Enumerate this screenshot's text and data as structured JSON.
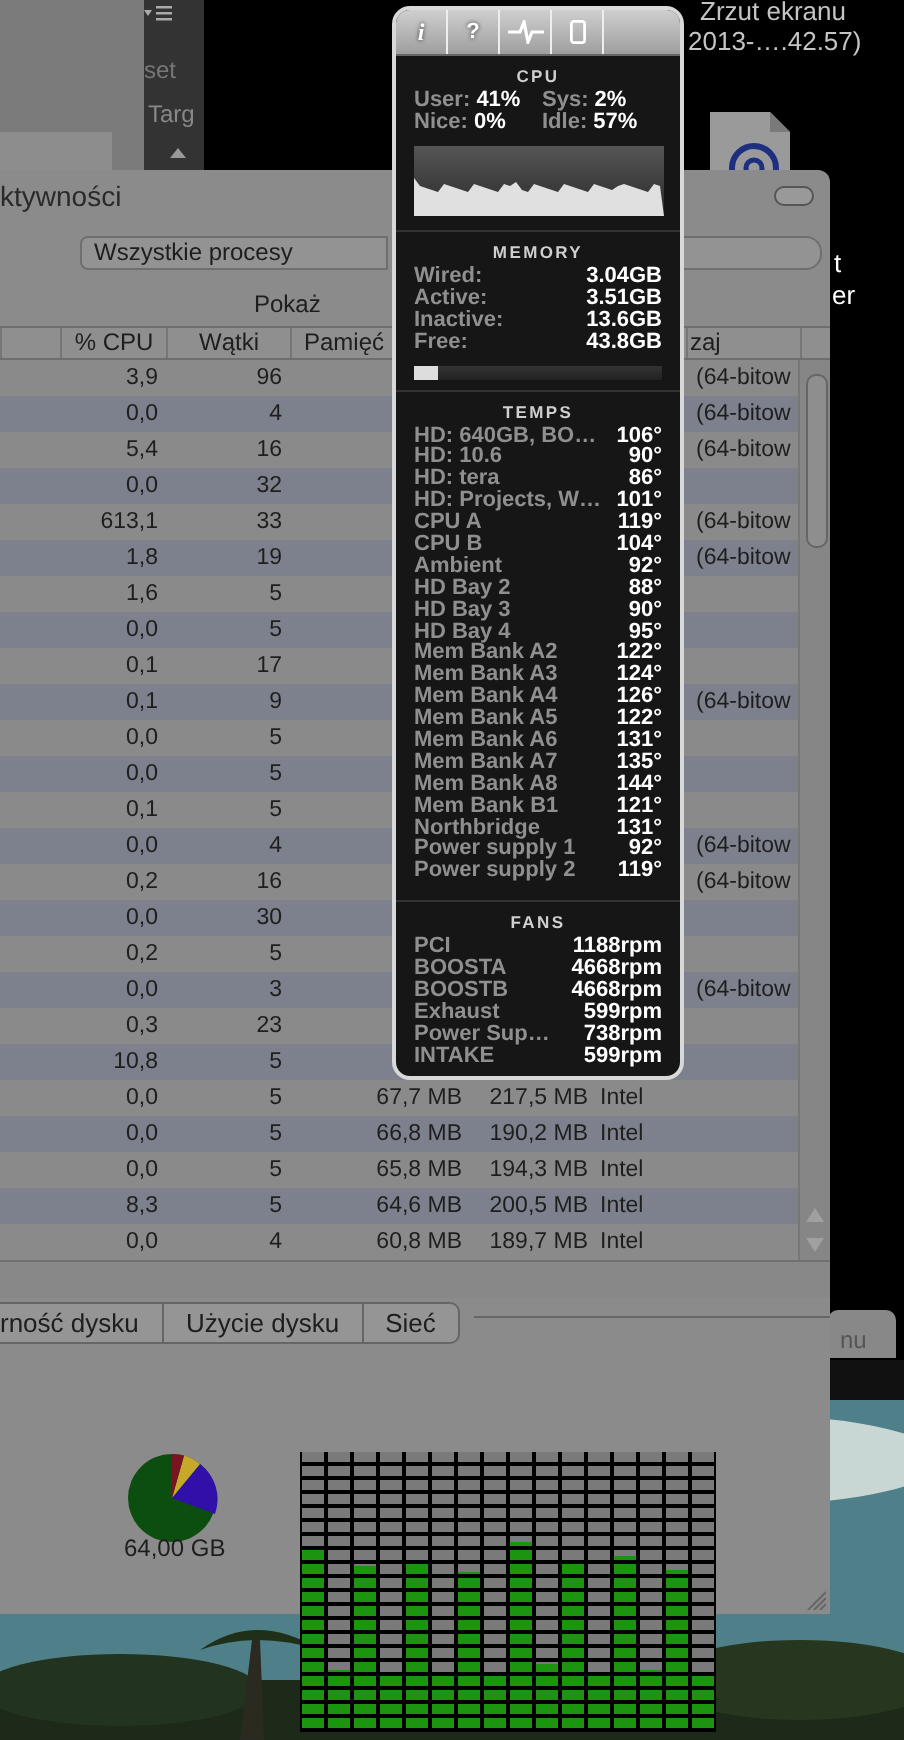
{
  "desktop": {
    "icon_label": "Zrzut ekranu",
    "icon_sublabel": "2013-….42.57)",
    "fragments": [
      {
        "kind": "field",
        "text": "set"
      },
      {
        "kind": "tab",
        "text": "Targ"
      },
      {
        "kind": "label1",
        "text": "t"
      },
      {
        "kind": "label2",
        "text": "er"
      },
      {
        "kind": "label3",
        "text": "nu"
      }
    ]
  },
  "activity_window": {
    "title": "ktywności",
    "filter": "Wszystkie procesy",
    "show_label": "Pokaż",
    "columns": [
      {
        "label": "% CPU"
      },
      {
        "label": "Wątki"
      },
      {
        "label": "Pamięć"
      },
      {
        "label": "zaj"
      }
    ],
    "rows": [
      {
        "cpu": "3,9",
        "threads": "96",
        "arch": "(64-bitow"
      },
      {
        "cpu": "0,0",
        "threads": "4",
        "arch": "(64-bitow"
      },
      {
        "cpu": "5,4",
        "threads": "16",
        "arch": "(64-bitow"
      },
      {
        "cpu": "0,0",
        "threads": "32"
      },
      {
        "cpu": "613,1",
        "threads": "33",
        "arch": "(64-bitow"
      },
      {
        "cpu": "1,8",
        "threads": "19",
        "arch": "(64-bitow"
      },
      {
        "cpu": "1,6",
        "threads": "5"
      },
      {
        "cpu": "0,0",
        "threads": "5"
      },
      {
        "cpu": "0,1",
        "threads": "17"
      },
      {
        "cpu": "0,1",
        "threads": "9",
        "arch": "(64-bitow"
      },
      {
        "cpu": "0,0",
        "threads": "5"
      },
      {
        "cpu": "0,0",
        "threads": "5"
      },
      {
        "cpu": "0,1",
        "threads": "5"
      },
      {
        "cpu": "0,0",
        "threads": "4",
        "arch": "(64-bitow"
      },
      {
        "cpu": "0,2",
        "threads": "16",
        "arch": "(64-bitow"
      },
      {
        "cpu": "0,0",
        "threads": "30"
      },
      {
        "cpu": "0,2",
        "threads": "5"
      },
      {
        "cpu": "0,0",
        "threads": "3",
        "arch": "(64-bitow"
      },
      {
        "cpu": "0,3",
        "threads": "23"
      },
      {
        "cpu": "10,8",
        "threads": "5"
      },
      {
        "cpu": "0,0",
        "threads": "5",
        "real_memory": "67,7 MB",
        "virtual_memory": "217,5 MB",
        "kind": "Intel"
      },
      {
        "cpu": "0,0",
        "threads": "5",
        "real_memory": "66,8 MB",
        "virtual_memory": "190,2 MB",
        "kind": "Intel"
      },
      {
        "cpu": "0,0",
        "threads": "5",
        "real_memory": "65,8 MB",
        "virtual_memory": "194,3 MB",
        "kind": "Intel"
      },
      {
        "cpu": "8,3",
        "threads": "5",
        "real_memory": "64,6 MB",
        "virtual_memory": "200,5 MB",
        "kind": "Intel"
      },
      {
        "cpu": "0,0",
        "threads": "4",
        "real_memory": "60,8 MB",
        "virtual_memory": "189,7 MB",
        "kind": "Intel"
      }
    ],
    "tabs": [
      {
        "label": "rność dysku",
        "selected": false
      },
      {
        "label": "Użycie dysku",
        "selected": false
      },
      {
        "label": "Sieć",
        "selected": false
      }
    ],
    "pane": {
      "kind": "picture",
      "caption": "64,00 GB"
    }
  },
  "stats_panel": {
    "buttons": [
      {
        "kind": "text",
        "label": "i"
      },
      {
        "kind": "text",
        "label": "?"
      },
      {
        "kind": "pulse"
      },
      {
        "kind": "device"
      }
    ],
    "cpu": {
      "title": "CPU",
      "stats": [
        {
          "label": "User:",
          "value": "41%"
        },
        {
          "label": "Sys:",
          "value": "2%"
        },
        {
          "label": "Nice:",
          "value": "0%"
        },
        {
          "label": "Idle:",
          "value": "57%"
        }
      ]
    },
    "memory": {
      "title": "MEMORY",
      "rows": [
        {
          "label": "Wired:",
          "value": "3.04GB"
        },
        {
          "label": "Active:",
          "value": "3.51GB"
        },
        {
          "label": "Inactive:",
          "value": "13.6GB"
        },
        {
          "label": "Free:",
          "value": "43.8GB"
        }
      ],
      "level": 0.1
    },
    "temps": {
      "title": "TEMPS",
      "rows": [
        {
          "label": "HD: 640GB, BO…",
          "value": "106°"
        },
        {
          "label": "HD: 10.6",
          "value": "90°"
        },
        {
          "label": "HD: tera",
          "value": "86°"
        },
        {
          "label": "HD: Projects, W…",
          "value": "101°"
        },
        {
          "label": "CPU A",
          "value": "119°"
        },
        {
          "label": "CPU B",
          "value": "104°"
        },
        {
          "label": "Ambient",
          "value": "92°"
        },
        {
          "label": "HD Bay 2",
          "value": "88°"
        },
        {
          "label": "HD Bay 3",
          "value": "90°"
        },
        {
          "label": "HD Bay 4",
          "value": "95°"
        },
        {
          "label": "Mem Bank A2",
          "value": "122°"
        },
        {
          "label": "Mem Bank A3",
          "value": "124°"
        },
        {
          "label": "Mem Bank A4",
          "value": "126°"
        },
        {
          "label": "Mem Bank A5",
          "value": "122°"
        },
        {
          "label": "Mem Bank A6",
          "value": "131°"
        },
        {
          "label": "Mem Bank A7",
          "value": "135°"
        },
        {
          "label": "Mem Bank A8",
          "value": "144°"
        },
        {
          "label": "Mem Bank B1",
          "value": "121°"
        },
        {
          "label": "Northbridge",
          "value": "131°"
        },
        {
          "label": "Power supply 1",
          "value": "92°"
        },
        {
          "label": "Power supply 2",
          "value": "119°"
        }
      ]
    },
    "fans": {
      "title": "FANS",
      "rows": [
        {
          "label": "PCI",
          "value": "1188rpm"
        },
        {
          "label": "BOOSTA",
          "value": "4668rpm"
        },
        {
          "label": "BOOSTB",
          "value": "4668rpm"
        },
        {
          "label": "Exhaust",
          "value": "599rpm"
        },
        {
          "label": "Power Sup…",
          "value": "738rpm"
        },
        {
          "label": "INTAKE",
          "value": "599rpm"
        }
      ]
    }
  },
  "meter_widget": {
    "columns": [
      {
        "level": 0.65
      },
      {
        "level": 0.22
      },
      {
        "level": 0.59
      },
      {
        "level": 0.2
      },
      {
        "level": 0.6
      },
      {
        "level": 0.2
      },
      {
        "level": 0.57
      },
      {
        "level": 0.2
      },
      {
        "level": 0.68
      },
      {
        "level": 0.24
      },
      {
        "level": 0.6
      },
      {
        "level": 0.2
      },
      {
        "level": 0.63
      },
      {
        "level": 0.22
      },
      {
        "level": 0.58
      },
      {
        "level": 0.2
      }
    ]
  }
}
